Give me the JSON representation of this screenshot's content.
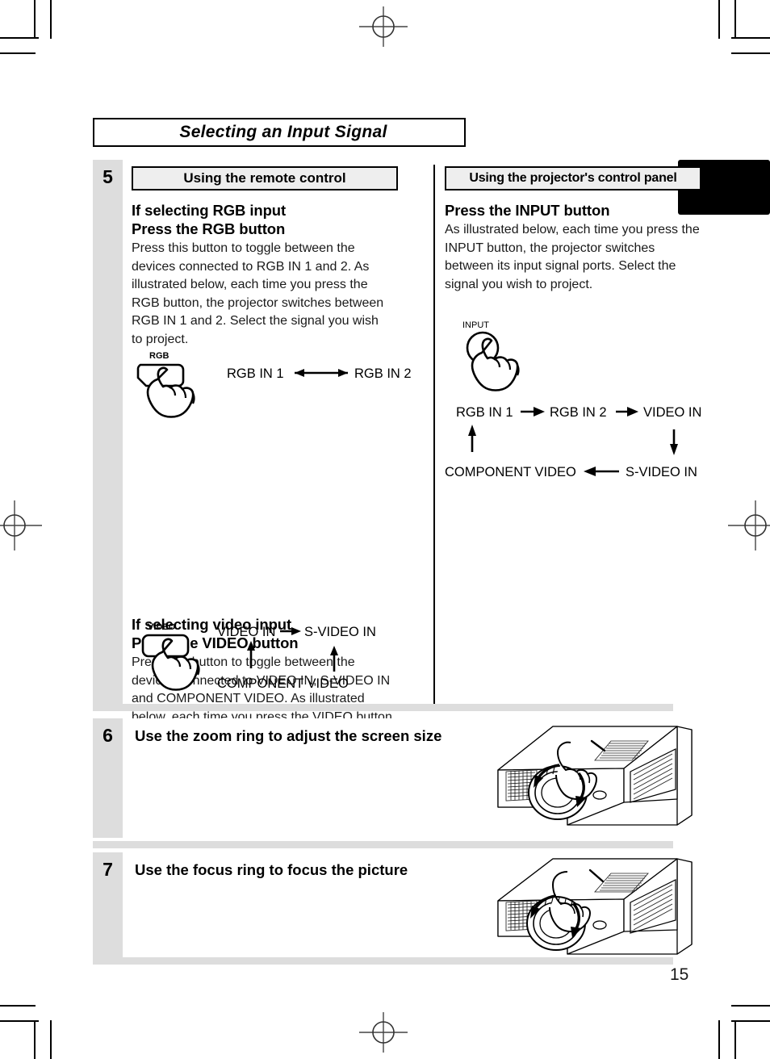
{
  "page": {
    "title": "Selecting an Input Signal",
    "number": "15"
  },
  "steps": [
    {
      "number": "5",
      "columns": {
        "left": {
          "header": "Using the remote control",
          "sections": [
            {
              "heading_line1": "If selecting RGB input",
              "heading_line2": "Press the RGB button",
              "body": "Press this button to toggle between the devices connected to RGB IN 1 and 2. As illustrated below, each time you press the RGB button, the projector switches between RGB IN 1 and 2. Select the signal you wish to project.",
              "button_label": "RGB",
              "flow": {
                "type": "two-way",
                "nodes": [
                  "RGB IN 1",
                  "RGB IN 2"
                ]
              }
            },
            {
              "heading_line1": "If selecting video input",
              "heading_line2": "Press the VIDEO button",
              "body": "Press this button to toggle between the devices connected to VIDEO IN, S-VIDEO IN and COMPONENT VIDEO. As illustrated below, each time you press the VIDEO button, the projector switches between VIDEO IN, S-VIDEO IN and COMPONENT VIDEO. Select the signal you wish to project.",
              "button_label": "VIDEO",
              "flow": {
                "type": "cycle-3",
                "nodes": [
                  "VIDEO IN",
                  "S-VIDEO IN",
                  "COMPONENT VIDEO"
                ]
              }
            }
          ]
        },
        "right": {
          "header": "Using the projector's control panel",
          "heading": "Press the INPUT button",
          "body": "As illustrated below, each time you press the INPUT button, the projector switches between its input signal ports. Select the signal you wish to project.",
          "button_label": "INPUT",
          "flow": {
            "type": "cycle-5",
            "nodes": [
              "RGB IN 1",
              "RGB IN 2",
              "VIDEO IN",
              "S-VIDEO IN",
              "COMPONENT VIDEO"
            ]
          }
        }
      }
    },
    {
      "number": "6",
      "title": "Use the zoom ring to adjust the screen size",
      "illustration": "projector-zoom-ring-hand"
    },
    {
      "number": "7",
      "title": "Use the focus ring to focus the picture",
      "illustration": "projector-focus-ring-hand"
    }
  ],
  "colors": {
    "step_column": "#dddddd",
    "header_box": "#eeeeee",
    "ink": "#000000",
    "section_tab": "#000000"
  }
}
